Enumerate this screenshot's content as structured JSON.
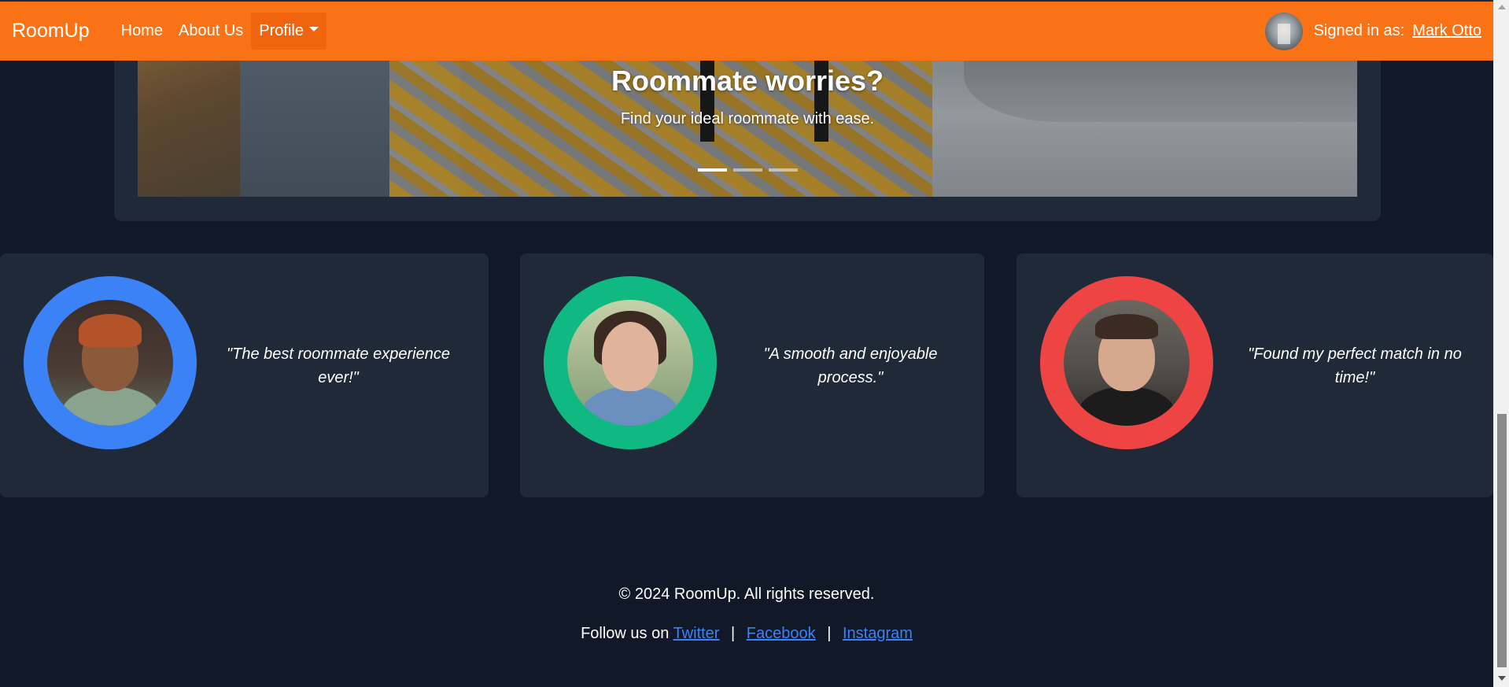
{
  "navbar": {
    "brand": "RoomUp",
    "links": [
      "Home",
      "About Us"
    ],
    "profile_label": "Profile",
    "signed_in_label": "Signed in as:",
    "user_name": "Mark Otto",
    "bg_color": "#f97316"
  },
  "hero": {
    "title": "Roommate worries?",
    "subtitle": "Find your ideal roommate with ease.",
    "slide_count": 3,
    "active_slide": 0
  },
  "testimonials": [
    {
      "quote": "\"The best roommate experience ever!\"",
      "ring_color": "#3b82f6"
    },
    {
      "quote": "\"A smooth and enjoyable process.\"",
      "ring_color": "#10b981"
    },
    {
      "quote": "\"Found my perfect match in no time!\"",
      "ring_color": "#ef4444"
    }
  ],
  "footer": {
    "copyright": "© 2024 RoomUp. All rights reserved.",
    "follow_label": "Follow us on",
    "socials": [
      "Twitter",
      "Facebook",
      "Instagram"
    ],
    "separator": "|"
  }
}
